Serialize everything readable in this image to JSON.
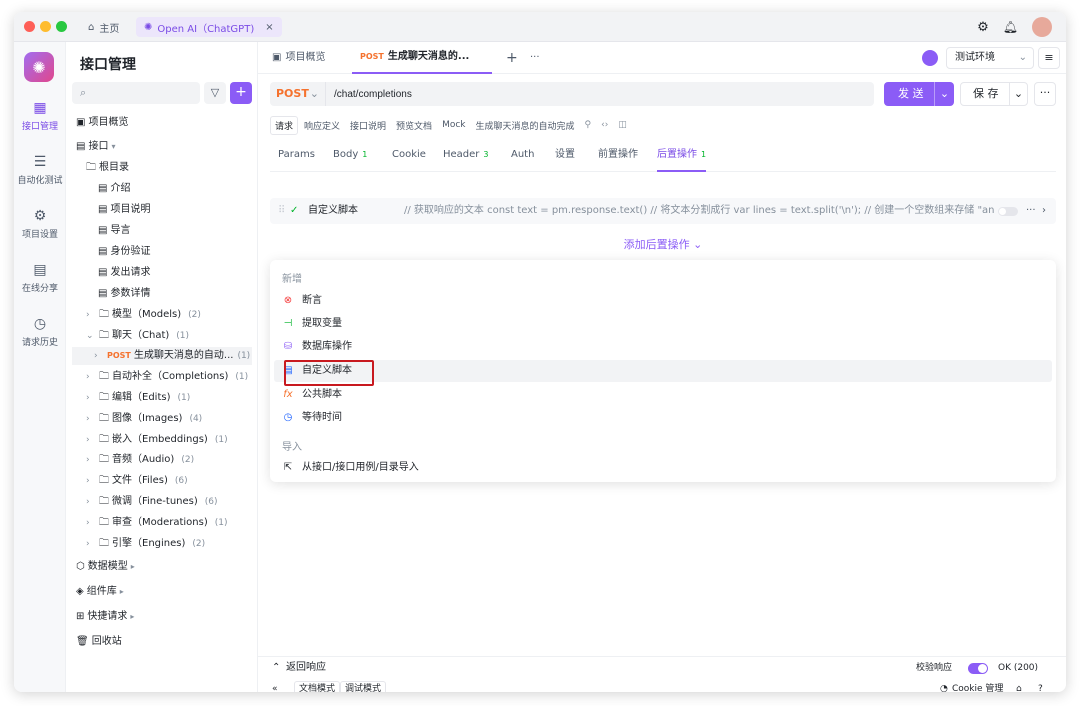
{
  "titlebar": {
    "home": "主页",
    "tab": "Open AI（ChatGPT)",
    "close": "×"
  },
  "iconbar": {
    "items": [
      {
        "label": "接口管理"
      },
      {
        "label": "自动化测试"
      },
      {
        "label": "项目设置"
      },
      {
        "label": "在线分享"
      },
      {
        "label": "请求历史"
      }
    ]
  },
  "tree": {
    "title": "接口管理",
    "search_placeholder": "",
    "add": "+",
    "overview": "项目概览",
    "api": "接口",
    "root": "根目录",
    "docs": [
      "介绍",
      "项目说明",
      "导言",
      "身份验证",
      "发出请求",
      "参数详情"
    ],
    "folders": [
      {
        "name": "模型（Models)",
        "count": "(2)"
      },
      {
        "name": "聊天（Chat)",
        "count": "(1)"
      },
      {
        "name": "自动补全（Completions)",
        "count": "(1)"
      },
      {
        "name": "编辑（Edits)",
        "count": "(1)"
      },
      {
        "name": "图像（Images)",
        "count": "(4)"
      },
      {
        "name": "嵌入（Embeddings)",
        "count": "(1)"
      },
      {
        "name": "音频（Audio)",
        "count": "(2)"
      },
      {
        "name": "文件（Files)",
        "count": "(6)"
      },
      {
        "name": "微调（Fine-tunes)",
        "count": "(6)"
      },
      {
        "name": "审查（Moderations)",
        "count": "(1)"
      },
      {
        "name": "引擎（Engines)",
        "count": "(2)"
      }
    ],
    "selected": {
      "method": "POST",
      "name": "生成聊天消息的自动...",
      "count": "(1)"
    },
    "sections": [
      "数据模型",
      "组件库",
      "快捷请求",
      "回收站"
    ]
  },
  "main": {
    "tabs": {
      "overview": "项目概览",
      "current_method": "POST",
      "current": "生成聊天消息的...",
      "plus": "+",
      "more": "···"
    },
    "env": "测试环境",
    "method": "POST",
    "url": "/chat/completions",
    "send": "发 送",
    "save": "保 存",
    "subtabs": [
      "请求",
      "响应定义",
      "接口说明",
      "预览文档",
      "Mock"
    ],
    "subtitle": "生成聊天消息的自动完成",
    "reqtabs": [
      {
        "label": "Params",
        "n": ""
      },
      {
        "label": "Body",
        "n": "1"
      },
      {
        "label": "Cookie",
        "n": ""
      },
      {
        "label": "Header",
        "n": "3"
      },
      {
        "label": "Auth",
        "n": ""
      },
      {
        "label": "设置",
        "n": ""
      },
      {
        "label": "前置操作",
        "n": ""
      },
      {
        "label": "后置操作",
        "n": "1"
      }
    ],
    "script": {
      "name": "自定义脚本",
      "code": "// 获取响应的文本 const text = pm.response.text() // 将文本分割成行 var lines = text.split('\\n'); // 创建一个空数组来存储 \"answer..."
    },
    "add_post": "添加后置操作",
    "dropdown": {
      "new_label": "新增",
      "items": [
        {
          "label": "断言",
          "icon": "assert-icon"
        },
        {
          "label": "提取变量",
          "icon": "extract-icon"
        },
        {
          "label": "数据库操作",
          "icon": "database-icon"
        },
        {
          "label": "自定义脚本",
          "icon": "script-icon"
        },
        {
          "label": "公共脚本",
          "icon": "fx-icon"
        },
        {
          "label": "等待时间",
          "icon": "clock-icon"
        }
      ],
      "import_label": "导入",
      "import_item": "从接口/接口用例/目录导入"
    },
    "bottom": {
      "response": "返回响应",
      "verify": "校验响应",
      "status": "OK (200)",
      "mode_doc": "文档模式",
      "mode_debug": "调试模式",
      "cookie": "Cookie 管理"
    }
  },
  "colors": {
    "accent": "#8b5cf6",
    "post": "#f5722e",
    "highlight": "#c8191f"
  }
}
